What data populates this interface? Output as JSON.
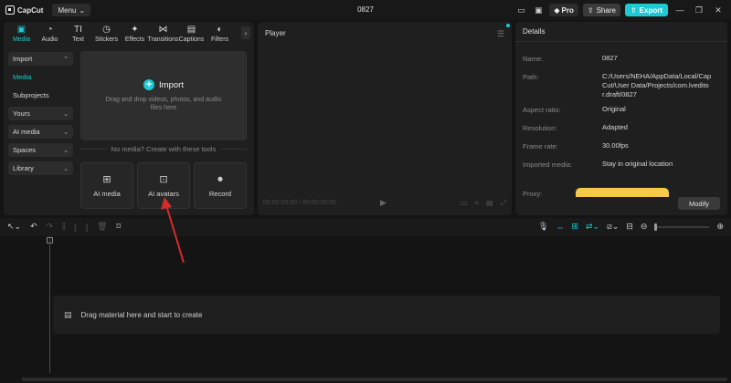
{
  "titlebar": {
    "app_name": "CapCut",
    "menu_label": "Menu",
    "project_title": "0827",
    "pro_label": "Pro",
    "share_label": "Share",
    "export_label": "Export"
  },
  "media_tabs": [
    {
      "label": "Media",
      "icon": "media-icon",
      "active": true
    },
    {
      "label": "Audio",
      "icon": "audio-icon"
    },
    {
      "label": "Text",
      "icon": "text-icon"
    },
    {
      "label": "Stickers",
      "icon": "stickers-icon"
    },
    {
      "label": "Effects",
      "icon": "effects-icon"
    },
    {
      "label": "Transitions",
      "icon": "transitions-icon"
    },
    {
      "label": "Captions",
      "icon": "captions-icon"
    },
    {
      "label": "Filters",
      "icon": "filters-icon"
    }
  ],
  "sidenav": {
    "import": "Import",
    "media": "Media",
    "subprojects": "Subprojects",
    "yours": "Yours",
    "ai_media": "AI media",
    "spaces": "Spaces",
    "library": "Library"
  },
  "import_box": {
    "label": "Import",
    "hint": "Drag and drop videos, photos, and audio files here"
  },
  "no_media_text": "No media? Create with these tools",
  "tool_cards": [
    {
      "label": "AI media",
      "icon": "ai-media-icon"
    },
    {
      "label": "AI avatars",
      "icon": "ai-avatars-icon"
    },
    {
      "label": "Record",
      "icon": "record-icon"
    }
  ],
  "player": {
    "title": "Player",
    "timecode": "00:00:00:00 / 00:00:00:00"
  },
  "details": {
    "title": "Details",
    "name_label": "Name:",
    "name_value": "0827",
    "path_label": "Path:",
    "path_value": "C:/Users/NEHA/AppData/Local/CapCut/User Data/Projects/com.lveditor.draft/0827",
    "aspect_label": "Aspect ratio:",
    "aspect_value": "Original",
    "resolution_label": "Resolution:",
    "resolution_value": "Adapted",
    "framerate_label": "Frame rate:",
    "framerate_value": "30.00fps",
    "imported_label": "Imported media:",
    "imported_value": "Stay in original location",
    "proxy_label": "Proxy:",
    "modify_label": "Modify"
  },
  "timeline": {
    "drop_hint": "Drag material here and start to create"
  },
  "colors": {
    "accent": "#1ec9d3",
    "annotation_arrow": "#d62b2b"
  }
}
